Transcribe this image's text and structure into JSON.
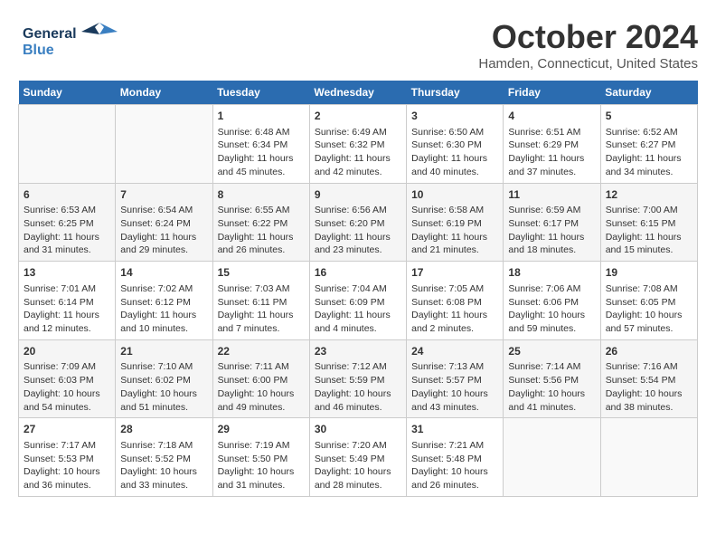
{
  "header": {
    "logo_line1": "General",
    "logo_line2": "Blue",
    "month": "October 2024",
    "location": "Hamden, Connecticut, United States"
  },
  "days_of_week": [
    "Sunday",
    "Monday",
    "Tuesday",
    "Wednesday",
    "Thursday",
    "Friday",
    "Saturday"
  ],
  "weeks": [
    [
      {
        "day": "",
        "info": ""
      },
      {
        "day": "",
        "info": ""
      },
      {
        "day": "1",
        "info": "Sunrise: 6:48 AM\nSunset: 6:34 PM\nDaylight: 11 hours and 45 minutes."
      },
      {
        "day": "2",
        "info": "Sunrise: 6:49 AM\nSunset: 6:32 PM\nDaylight: 11 hours and 42 minutes."
      },
      {
        "day": "3",
        "info": "Sunrise: 6:50 AM\nSunset: 6:30 PM\nDaylight: 11 hours and 40 minutes."
      },
      {
        "day": "4",
        "info": "Sunrise: 6:51 AM\nSunset: 6:29 PM\nDaylight: 11 hours and 37 minutes."
      },
      {
        "day": "5",
        "info": "Sunrise: 6:52 AM\nSunset: 6:27 PM\nDaylight: 11 hours and 34 minutes."
      }
    ],
    [
      {
        "day": "6",
        "info": "Sunrise: 6:53 AM\nSunset: 6:25 PM\nDaylight: 11 hours and 31 minutes."
      },
      {
        "day": "7",
        "info": "Sunrise: 6:54 AM\nSunset: 6:24 PM\nDaylight: 11 hours and 29 minutes."
      },
      {
        "day": "8",
        "info": "Sunrise: 6:55 AM\nSunset: 6:22 PM\nDaylight: 11 hours and 26 minutes."
      },
      {
        "day": "9",
        "info": "Sunrise: 6:56 AM\nSunset: 6:20 PM\nDaylight: 11 hours and 23 minutes."
      },
      {
        "day": "10",
        "info": "Sunrise: 6:58 AM\nSunset: 6:19 PM\nDaylight: 11 hours and 21 minutes."
      },
      {
        "day": "11",
        "info": "Sunrise: 6:59 AM\nSunset: 6:17 PM\nDaylight: 11 hours and 18 minutes."
      },
      {
        "day": "12",
        "info": "Sunrise: 7:00 AM\nSunset: 6:15 PM\nDaylight: 11 hours and 15 minutes."
      }
    ],
    [
      {
        "day": "13",
        "info": "Sunrise: 7:01 AM\nSunset: 6:14 PM\nDaylight: 11 hours and 12 minutes."
      },
      {
        "day": "14",
        "info": "Sunrise: 7:02 AM\nSunset: 6:12 PM\nDaylight: 11 hours and 10 minutes."
      },
      {
        "day": "15",
        "info": "Sunrise: 7:03 AM\nSunset: 6:11 PM\nDaylight: 11 hours and 7 minutes."
      },
      {
        "day": "16",
        "info": "Sunrise: 7:04 AM\nSunset: 6:09 PM\nDaylight: 11 hours and 4 minutes."
      },
      {
        "day": "17",
        "info": "Sunrise: 7:05 AM\nSunset: 6:08 PM\nDaylight: 11 hours and 2 minutes."
      },
      {
        "day": "18",
        "info": "Sunrise: 7:06 AM\nSunset: 6:06 PM\nDaylight: 10 hours and 59 minutes."
      },
      {
        "day": "19",
        "info": "Sunrise: 7:08 AM\nSunset: 6:05 PM\nDaylight: 10 hours and 57 minutes."
      }
    ],
    [
      {
        "day": "20",
        "info": "Sunrise: 7:09 AM\nSunset: 6:03 PM\nDaylight: 10 hours and 54 minutes."
      },
      {
        "day": "21",
        "info": "Sunrise: 7:10 AM\nSunset: 6:02 PM\nDaylight: 10 hours and 51 minutes."
      },
      {
        "day": "22",
        "info": "Sunrise: 7:11 AM\nSunset: 6:00 PM\nDaylight: 10 hours and 49 minutes."
      },
      {
        "day": "23",
        "info": "Sunrise: 7:12 AM\nSunset: 5:59 PM\nDaylight: 10 hours and 46 minutes."
      },
      {
        "day": "24",
        "info": "Sunrise: 7:13 AM\nSunset: 5:57 PM\nDaylight: 10 hours and 43 minutes."
      },
      {
        "day": "25",
        "info": "Sunrise: 7:14 AM\nSunset: 5:56 PM\nDaylight: 10 hours and 41 minutes."
      },
      {
        "day": "26",
        "info": "Sunrise: 7:16 AM\nSunset: 5:54 PM\nDaylight: 10 hours and 38 minutes."
      }
    ],
    [
      {
        "day": "27",
        "info": "Sunrise: 7:17 AM\nSunset: 5:53 PM\nDaylight: 10 hours and 36 minutes."
      },
      {
        "day": "28",
        "info": "Sunrise: 7:18 AM\nSunset: 5:52 PM\nDaylight: 10 hours and 33 minutes."
      },
      {
        "day": "29",
        "info": "Sunrise: 7:19 AM\nSunset: 5:50 PM\nDaylight: 10 hours and 31 minutes."
      },
      {
        "day": "30",
        "info": "Sunrise: 7:20 AM\nSunset: 5:49 PM\nDaylight: 10 hours and 28 minutes."
      },
      {
        "day": "31",
        "info": "Sunrise: 7:21 AM\nSunset: 5:48 PM\nDaylight: 10 hours and 26 minutes."
      },
      {
        "day": "",
        "info": ""
      },
      {
        "day": "",
        "info": ""
      }
    ]
  ]
}
